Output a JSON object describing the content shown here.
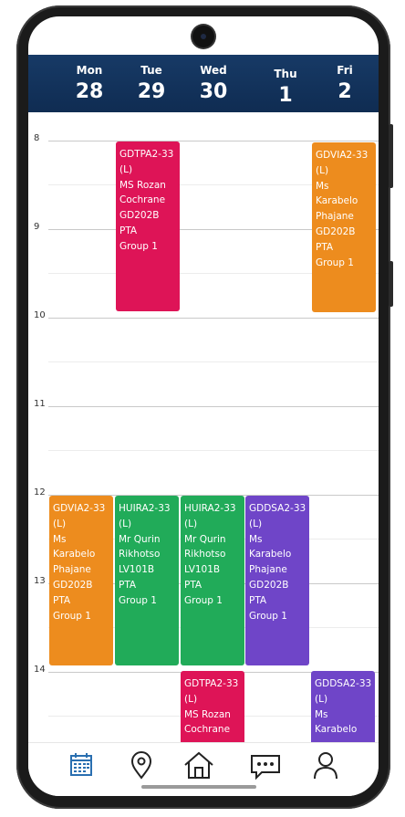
{
  "days": [
    {
      "name": "Mon",
      "num": "28"
    },
    {
      "name": "Tue",
      "num": "29"
    },
    {
      "name": "Wed",
      "num": "30"
    },
    {
      "name": "Thu",
      "num": "1"
    },
    {
      "name": "Fri",
      "num": "2"
    }
  ],
  "hours": [
    "8",
    "9",
    "10",
    "11",
    "12",
    "13",
    "14"
  ],
  "events": [
    {
      "lines": [
        "GDTPA2-33",
        "(L)",
        "MS Rozan",
        "Cochrane",
        "GD202B",
        "PTA",
        "Group 1"
      ],
      "color": "#de1457"
    },
    {
      "lines": [
        "GDVIA2-33",
        "(L)",
        "Ms",
        "Karabelo",
        "Phajane",
        "GD202B",
        "PTA",
        "Group 1"
      ],
      "color": "#ed8c1e"
    },
    {
      "lines": [
        "GDVIA2-33",
        "(L)",
        "Ms",
        "Karabelo",
        "Phajane",
        "GD202B",
        "PTA",
        "Group 1"
      ],
      "color": "#ed8c1e"
    },
    {
      "lines": [
        "HUIRA2-33",
        "(L)",
        "Mr Qurin",
        "Rikhotso",
        "LV101B",
        "PTA",
        "Group 1"
      ],
      "color": "#21ab59"
    },
    {
      "lines": [
        "HUIRA2-33",
        "(L)",
        "Mr Qurin",
        "Rikhotso",
        "LV101B",
        "PTA",
        "Group 1"
      ],
      "color": "#21ab59"
    },
    {
      "lines": [
        "GDDSA2-33",
        "(L)",
        "Ms",
        "Karabelo",
        "Phajane",
        "GD202B",
        "PTA",
        "Group 1"
      ],
      "color": "#6f45c8"
    },
    {
      "lines": [
        "GDTPA2-33",
        "(L)",
        "MS Rozan",
        "Cochrane"
      ],
      "color": "#de1457"
    },
    {
      "lines": [
        "GDDSA2-33",
        "(L)",
        "Ms",
        "Karabelo"
      ],
      "color": "#6f45c8"
    }
  ],
  "nav": [
    {
      "icon": "calendar-icon",
      "active": true
    },
    {
      "icon": "location-pin-icon",
      "active": false
    },
    {
      "icon": "home-icon",
      "active": false
    },
    {
      "icon": "messages-icon",
      "active": false
    },
    {
      "icon": "profile-icon",
      "active": false
    }
  ],
  "colors": {
    "header": "#173a66",
    "active_nav": "#2a6fb0"
  }
}
